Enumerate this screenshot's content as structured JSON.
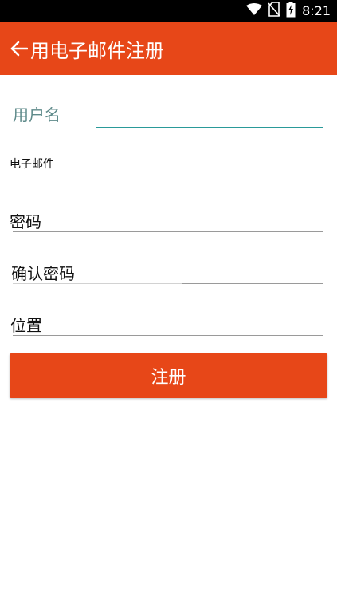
{
  "status_bar": {
    "time": "8:21",
    "icons": [
      "wifi-icon",
      "no-sim-icon",
      "battery-charging-icon"
    ]
  },
  "app_bar": {
    "back_icon": "arrow-left-icon",
    "title": "用电子邮件注册"
  },
  "form": {
    "username": {
      "placeholder": "用户名",
      "value": ""
    },
    "email": {
      "label": "电子邮件",
      "value": ""
    },
    "password": {
      "label": "密码",
      "value": ""
    },
    "confirm_password": {
      "label": "确认密码",
      "value": ""
    },
    "location": {
      "label": "位置",
      "value": ""
    }
  },
  "register_button": {
    "label": "注册"
  },
  "colors": {
    "accent": "#E74718",
    "focus_line": "#2A9A99",
    "line": "#9A9A9A",
    "hint": "#5E8A8A"
  }
}
